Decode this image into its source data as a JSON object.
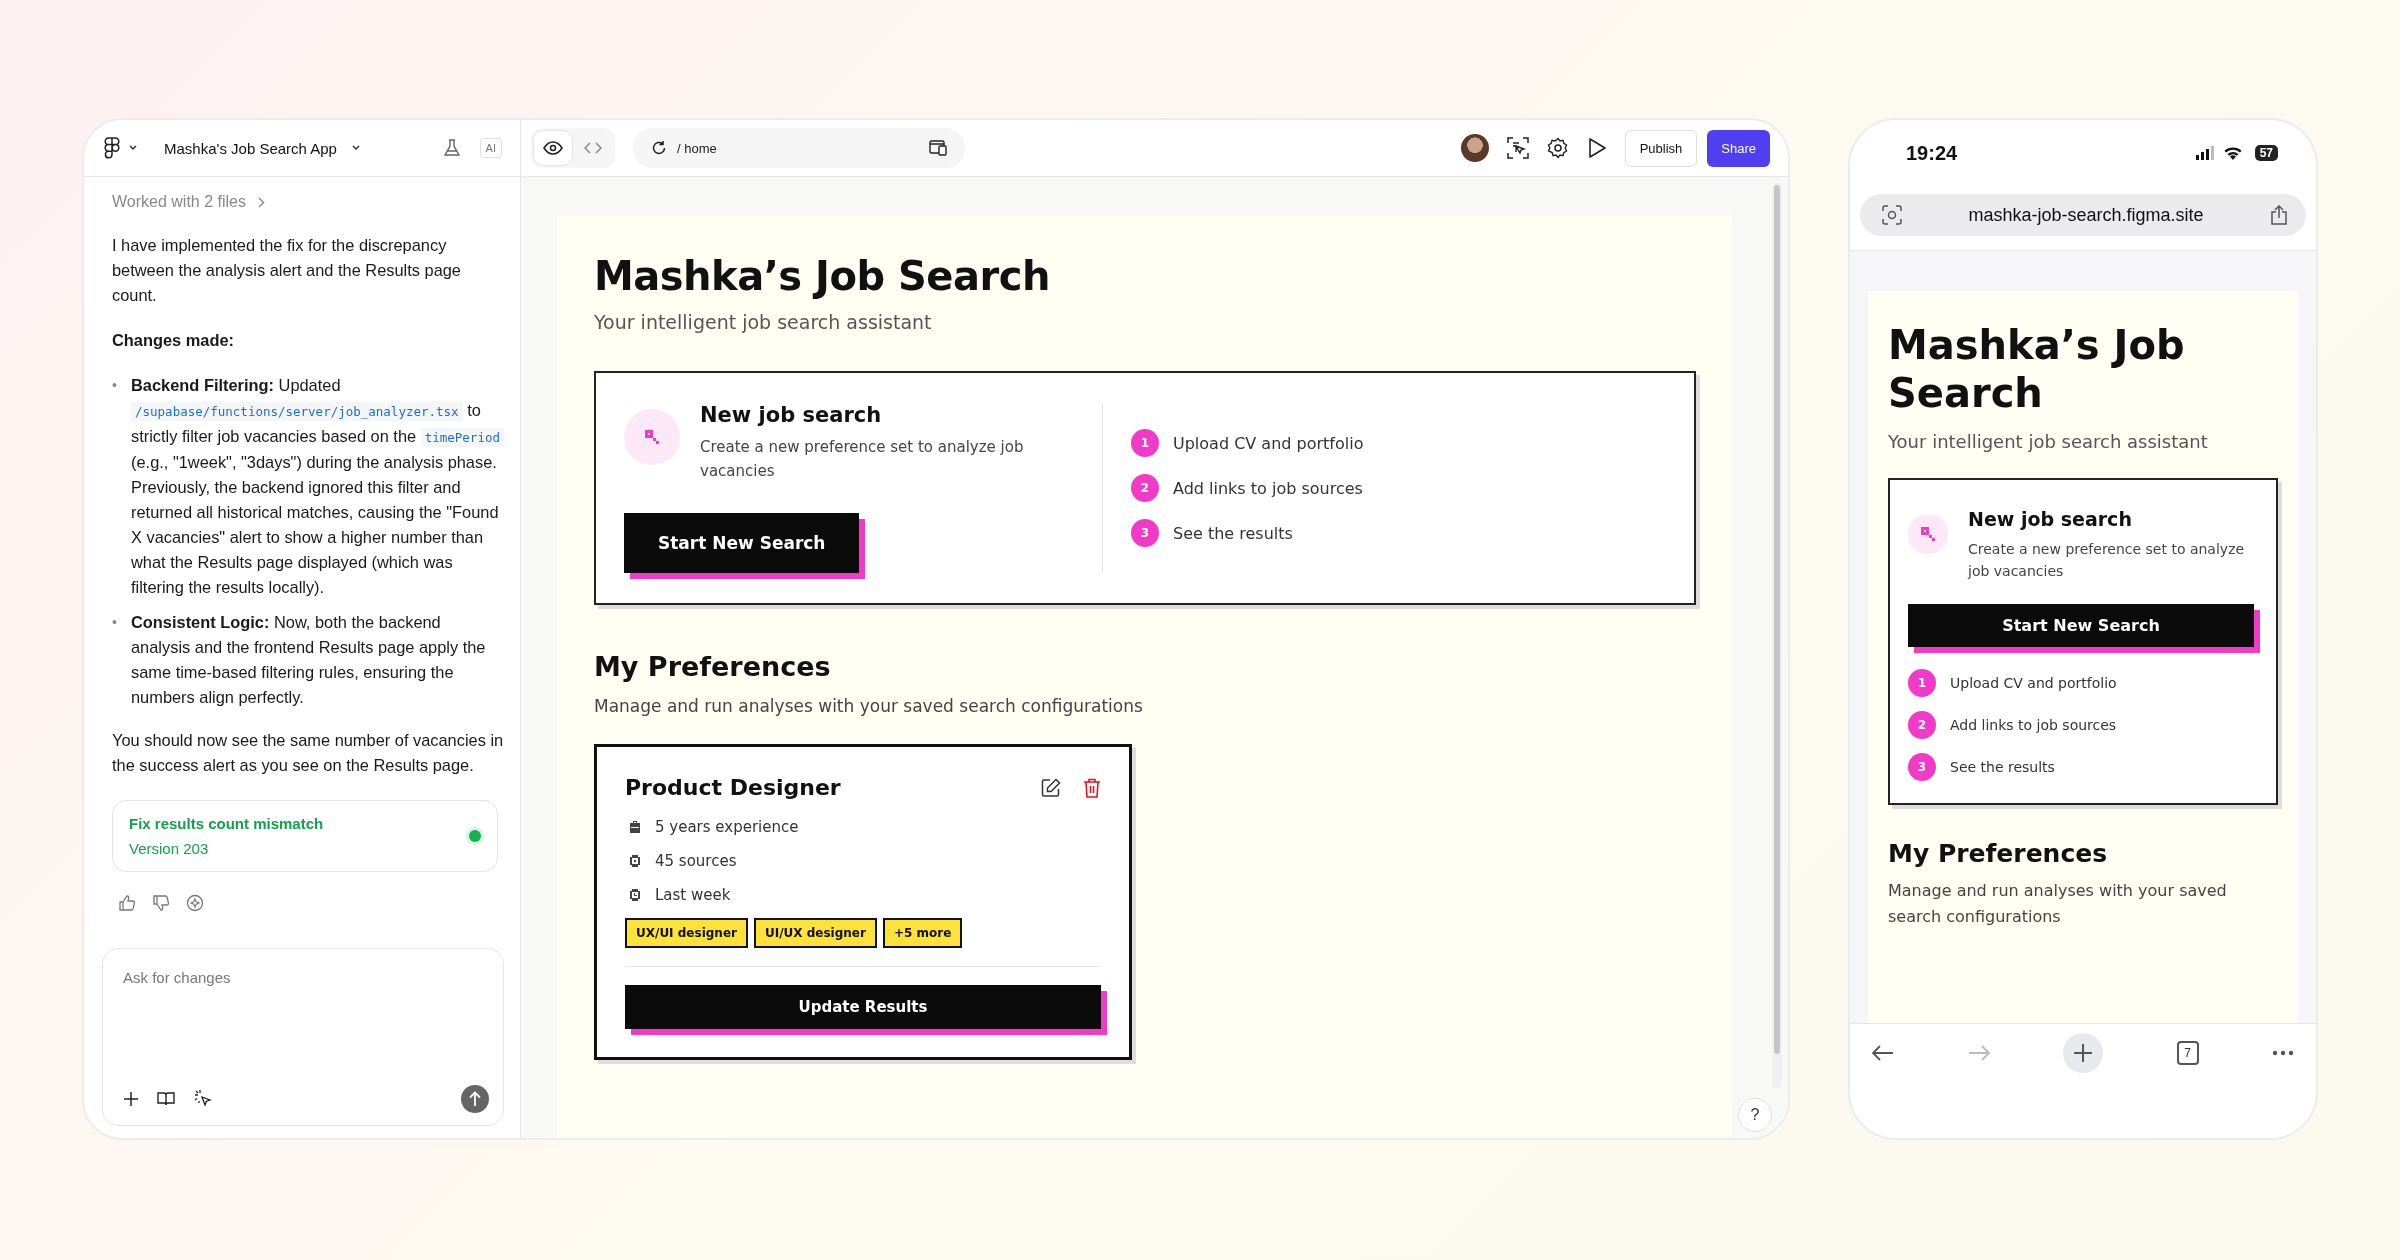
{
  "chat_panel": {
    "project_title": "Mashka's Job Search App",
    "ai_badge": "AI",
    "worked_with": "Worked with 2 files",
    "intro": "I have implemented the fix for the discrepancy between the analysis alert and the Results page count.",
    "changes_heading": "Changes made:",
    "bullets": [
      {
        "marker": "•",
        "segments": [
          {
            "kind": "text",
            "text": "**Backend Filtering:** Updated "
          },
          {
            "kind": "code",
            "text": "/supabase/functions/server/job_analyzer.tsx"
          },
          {
            "kind": "text",
            "text": " to strictly filter job vacancies based on the "
          },
          {
            "kind": "code",
            "text": "timePeriod"
          },
          {
            "kind": "text",
            "text": " (e.g., \"1week\", \"3days\") during the analysis phase. Previously, the backend ignored this filter and returned all historical matches, causing the \"Found X vacancies\" alert to show a higher number than what the Results page displayed (which was filtering the results locally)."
          }
        ]
      },
      {
        "marker": "•",
        "segments": [
          {
            "kind": "text",
            "text": "**Consistent Logic:** Now, both the backend analysis and the frontend Results page apply the same time-based filtering rules, ensuring the numbers align perfectly."
          }
        ]
      }
    ],
    "outro": "You should now see the same number of vacancies in the success alert as you see on the Results page.",
    "version_card": {
      "title": "Fix results count mismatch",
      "version": "Version 203"
    },
    "input": {
      "placeholder": "Ask for changes"
    }
  },
  "toolbar": {
    "view_modes": [
      {
        "kind": "preview",
        "selected": true
      },
      {
        "kind": "code",
        "selected": false
      }
    ],
    "path": "/ home",
    "publish": "Publish",
    "share": "Share"
  },
  "desktop_page": {
    "title": "Mashka’s Job Search",
    "subtitle": "Your intelligent job search assistant",
    "new_search": {
      "title": "New job search",
      "description": "Create a new preference set to analyze job vacancies",
      "button": "Start New Search",
      "steps": [
        {
          "number": "1",
          "text": "Upload CV and portfolio"
        },
        {
          "number": "2",
          "text": "Add links to job sources"
        },
        {
          "number": "3",
          "text": "See the results"
        }
      ]
    },
    "preferences": {
      "title": "My Preferences",
      "subtitle": "Manage and run analyses with your saved search configurations",
      "cards": [
        {
          "title": "Product Designer",
          "details": [
            {
              "kind": "experience",
              "text": "5 years experience"
            },
            {
              "kind": "sources",
              "text": "45 sources"
            },
            {
              "kind": "period",
              "text": "Last week"
            }
          ],
          "tags": [
            "UX/UI designer",
            "UI/UX designer",
            "+5 more"
          ],
          "button": "Update Results"
        }
      ]
    },
    "help": "?"
  },
  "phone": {
    "time": "19:24",
    "battery": "57",
    "url": "mashka-job-search.figma.site",
    "page": {
      "title": "Mashka’s Job Search",
      "subtitle": "Your intelligent job search assistant",
      "new_search": {
        "title": "New job search",
        "description": "Create a new preference set to analyze job vacancies",
        "button": "Start New Search",
        "steps": [
          {
            "number": "1",
            "text": "Upload CV and portfolio"
          },
          {
            "number": "2",
            "text": "Add links to job sources"
          },
          {
            "number": "3",
            "text": "See the results"
          }
        ]
      },
      "preferences": {
        "title": "My Preferences",
        "subtitle": "Manage and run analyses with your saved search configurations"
      }
    },
    "tab_count": "7"
  }
}
